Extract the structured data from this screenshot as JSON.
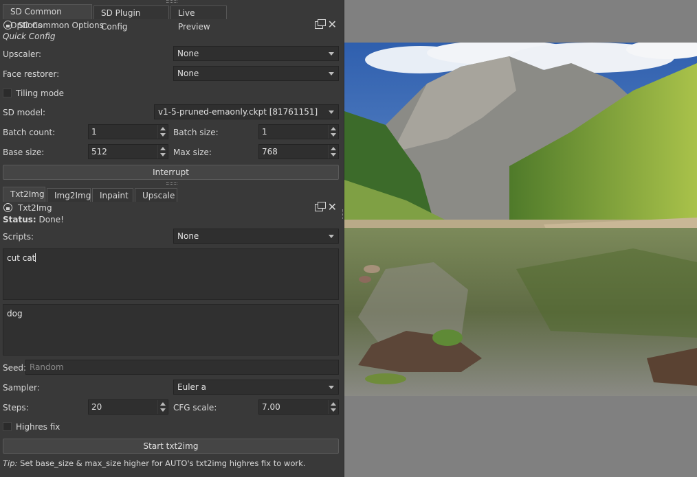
{
  "top_tabs": [
    "SD Common Options",
    "SD Plugin Config",
    "Live Preview"
  ],
  "common_dock": {
    "title": "SD Common Options",
    "section": "Quick Config",
    "upscaler": {
      "label": "Upscaler:",
      "value": "None"
    },
    "face_restorer": {
      "label": "Face restorer:",
      "value": "None"
    },
    "tiling": {
      "label": "Tiling mode"
    },
    "sd_model": {
      "label": "SD model:",
      "value": "v1-5-pruned-emaonly.ckpt [81761151]"
    },
    "batch_count": {
      "label": "Batch count:",
      "value": "1"
    },
    "batch_size": {
      "label": "Batch size:",
      "value": "1"
    },
    "base_size": {
      "label": "Base size:",
      "value": "512"
    },
    "max_size": {
      "label": "Max size:",
      "value": "768"
    },
    "interrupt": "Interrupt"
  },
  "mode_tabs": [
    "Txt2Img",
    "Img2Img",
    "Inpaint",
    "Upscale"
  ],
  "txt_dock": {
    "title": "Txt2Img",
    "status_label": "Status:",
    "status_value": "Done!",
    "scripts": {
      "label": "Scripts:",
      "value": "None"
    },
    "prompt": "cut cat",
    "negative_prompt": "dog",
    "seed": {
      "label": "Seed:",
      "placeholder": "Random"
    },
    "sampler": {
      "label": "Sampler:",
      "value": "Euler a"
    },
    "steps": {
      "label": "Steps:",
      "value": "20"
    },
    "cfg": {
      "label": "CFG scale:",
      "value": "7.00"
    },
    "highres": {
      "label": "Highres fix"
    },
    "start": "Start txt2img",
    "tip_prefix": "Tip:",
    "tip_text": "Set base_size & max_size higher for AUTO's txt2img highres fix to work."
  },
  "colors": {
    "panel_bg": "#393939",
    "canvas_bg": "#808080",
    "field_bg": "#2f2f2f"
  }
}
